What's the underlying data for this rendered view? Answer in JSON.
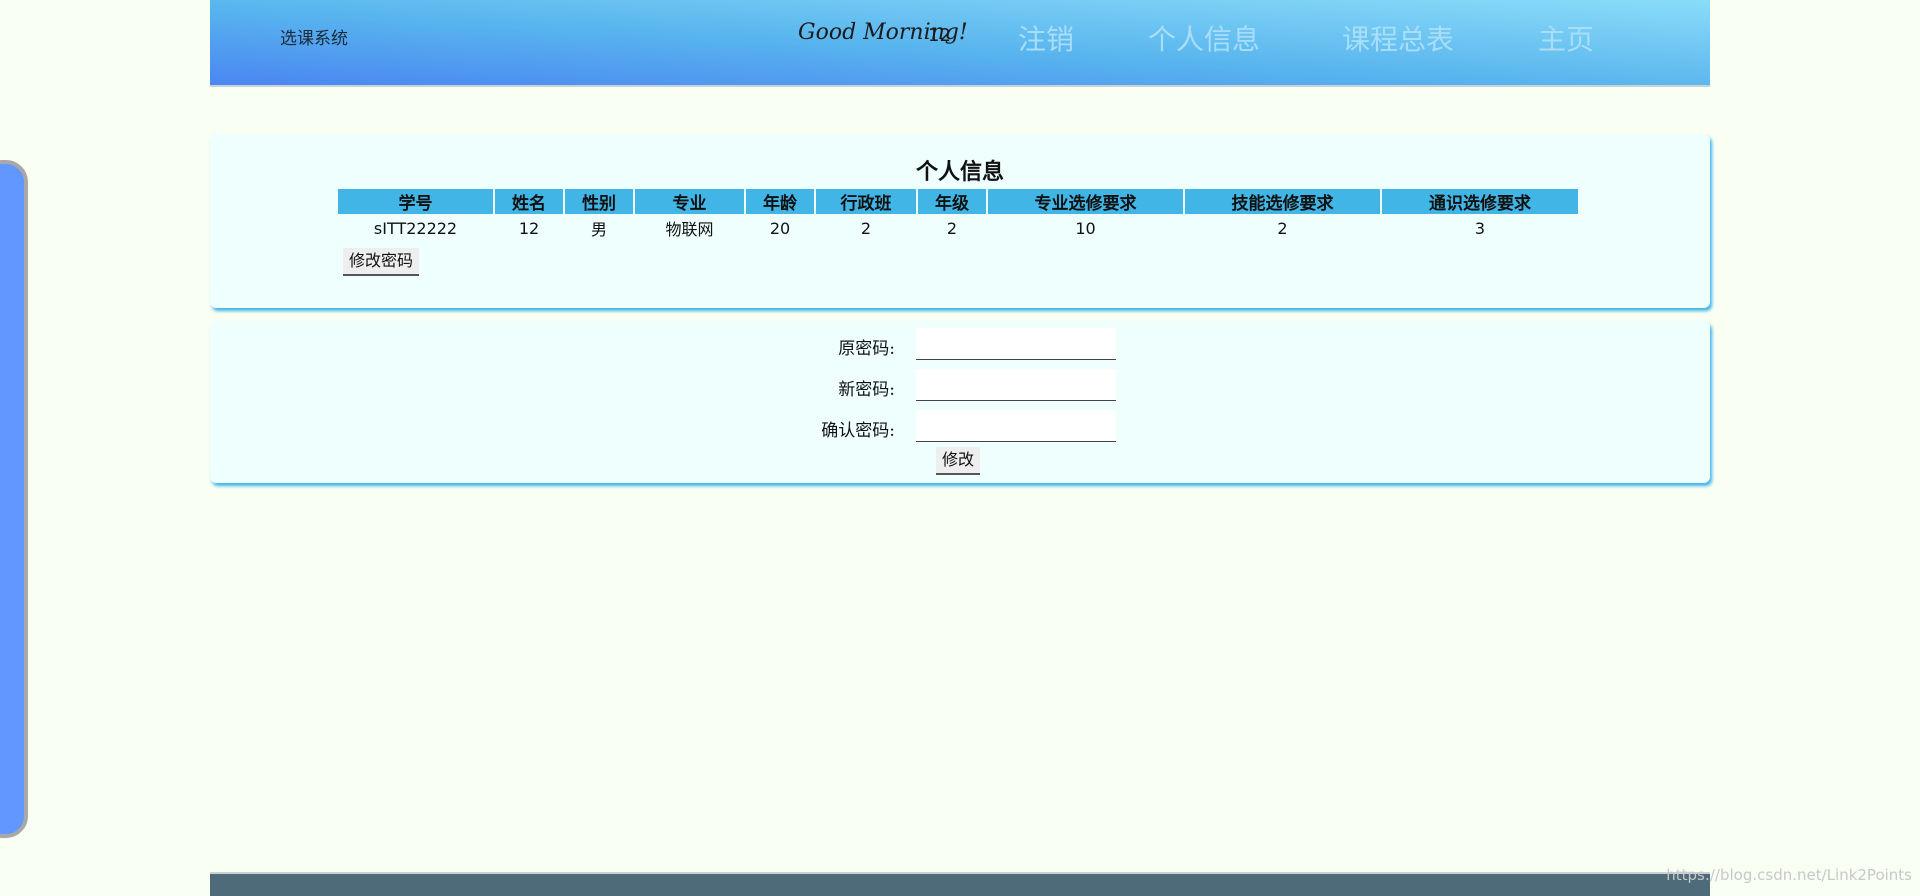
{
  "header": {
    "brand": "选课系统",
    "greeting": "Good Morning!",
    "username": "12",
    "nav": [
      "注销",
      "个人信息",
      "课程总表",
      "主页"
    ]
  },
  "profile": {
    "title": "个人信息",
    "columns": [
      "学号",
      "姓名",
      "性别",
      "专业",
      "年龄",
      "行政班",
      "年级",
      "专业选修要求",
      "技能选修要求",
      "通识选修要求"
    ],
    "row": [
      "sITT22222",
      "12",
      "男",
      "物联网",
      "20",
      "2",
      "2",
      "10",
      "2",
      "3"
    ],
    "change_password_button": "修改密码"
  },
  "password_form": {
    "old_label": "原密码:",
    "new_label": "新密码:",
    "confirm_label": "确认密码:",
    "old_value": "",
    "new_value": "",
    "confirm_value": "",
    "submit_button": "修改"
  },
  "watermark": "https://blog.csdn.net/Link2Points"
}
